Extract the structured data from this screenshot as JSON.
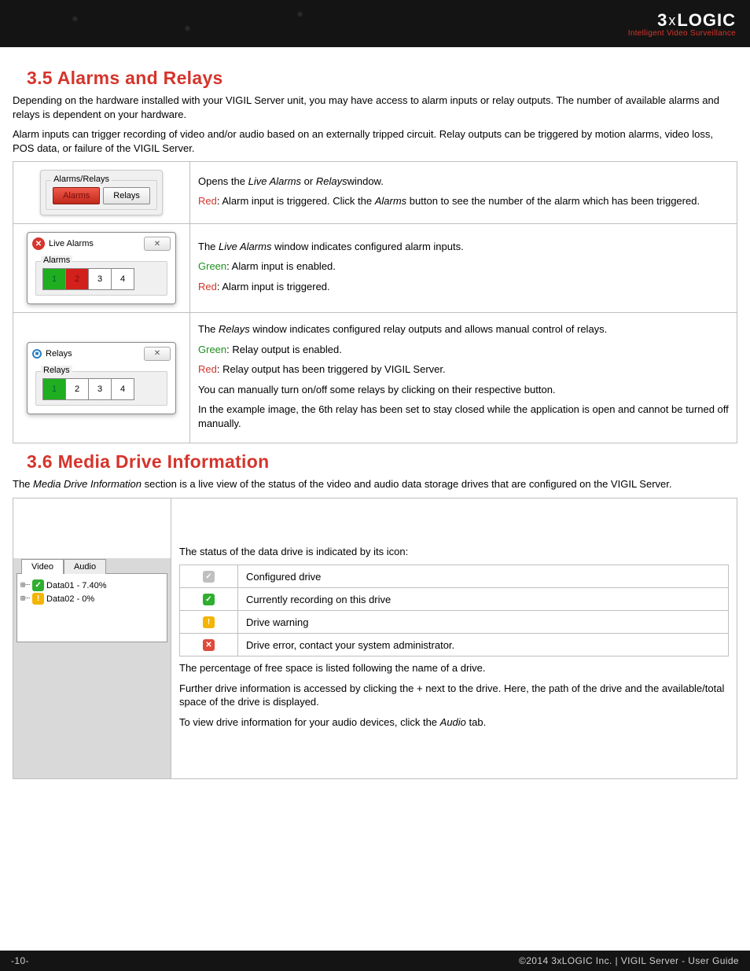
{
  "header": {
    "logo_main_pre": "3",
    "logo_main_x": "x",
    "logo_main_post": "LOGIC",
    "logo_sub": "Intelligent Video Surveillance"
  },
  "sec35": {
    "heading": "3.5 Alarms and Relays",
    "p1": "Depending on the hardware installed with your VIGIL Server unit, you may have access to alarm inputs or relay outputs. The number of available alarms and relays is dependent on your hardware.",
    "p2": "Alarm inputs can trigger recording of video and/or audio based on an externally tripped circuit. Relay outputs can be triggered by motion alarms, video loss, POS data, or failure of the VIGIL Server.",
    "row1": {
      "widget_legend": "Alarms/Relays",
      "btn_alarms": "Alarms",
      "btn_relays": "Relays",
      "desc_open_pre": "Opens the ",
      "desc_open_em1": "Live Alarms",
      "desc_open_mid": " or ",
      "desc_open_em2": "Relays",
      "desc_open_post": "window.",
      "red_label": "Red",
      "red_rest_pre": ": Alarm input is triggered. Click the ",
      "red_rest_em": "Alarms",
      "red_rest_post": " button to see the number of the alarm which has been triggered."
    },
    "row2": {
      "win_title": "Live Alarms",
      "fs_legend": "Alarms",
      "n1": "1",
      "n2": "2",
      "n3": "3",
      "n4": "4",
      "desc_pre": "The ",
      "desc_em": "Live Alarms",
      "desc_post": " window indicates configured alarm inputs.",
      "green_label": "Green",
      "green_rest": ": Alarm input is enabled.",
      "red_label": "Red",
      "red_rest": ": Alarm input is triggered."
    },
    "row3": {
      "win_title": "Relays",
      "fs_legend": "Relays",
      "n1": "1",
      "n2": "2",
      "n3": "3",
      "n4": "4",
      "desc_pre": "The ",
      "desc_em": "Relays",
      "desc_post": " window indicates configured relay outputs and allows manual control of relays.",
      "green_label": "Green",
      "green_rest": ": Relay output is enabled.",
      "red_label": "Red",
      "red_rest": ": Relay output has been triggered by VIGIL Server.",
      "manual": "You can manually turn on/off some relays by clicking on their respective button.",
      "example": "In the example image, the 6th relay has been set to stay closed while the application is open and cannot be turned off manually."
    }
  },
  "sec36": {
    "heading": "3.6 Media Drive Information",
    "intro_pre": "The ",
    "intro_em": "Media Drive Information",
    "intro_post": " section is a live view of the status of the video and audio data storage drives that are configured on the VIGIL Server.",
    "panel": {
      "tab_video": "Video",
      "tab_audio": "Audio",
      "drive1": "Data01 - 7.40%",
      "drive2": "Data02 - 0%"
    },
    "status_intro": "The status of the data drive is indicated by its icon:",
    "rows": {
      "configured": "Configured drive",
      "recording": "Currently recording on this drive",
      "warning": "Drive warning",
      "error": "Drive error, contact your system administrator."
    },
    "pct": "The percentage of free space is listed following the name of a drive.",
    "further": "Further drive information is accessed by clicking the + next to the drive. Here, the path of the drive and the available/total space of the drive is displayed.",
    "audio_pre": "To view drive information for your audio devices, click the ",
    "audio_em": "Audio",
    "audio_post": " tab."
  },
  "footer": {
    "page": "-10-",
    "right": "©2014 3xLOGIC Inc.  |  VIGIL Server - User Guide"
  }
}
